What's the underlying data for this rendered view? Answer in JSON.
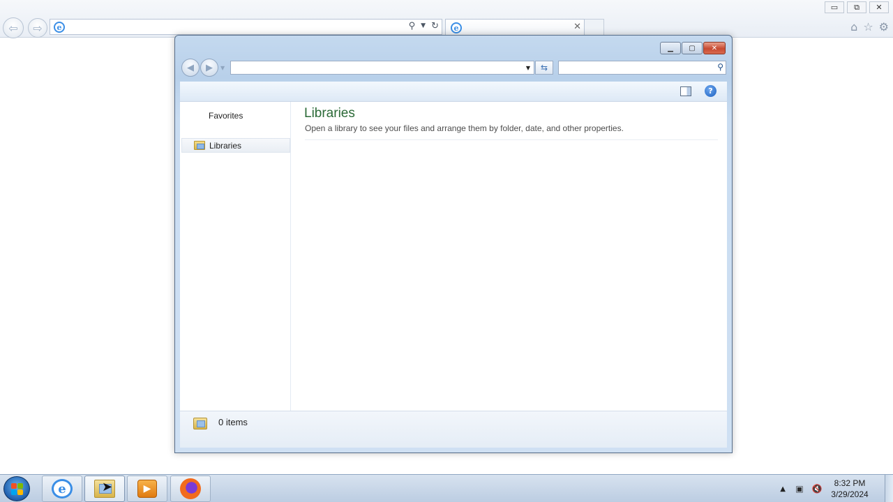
{
  "browser": {
    "address_value": "",
    "tab_title": "",
    "window_controls": {
      "minimize": "▭",
      "restore": "⧉",
      "close": "✕"
    },
    "toolbar_icons": [
      "home-icon",
      "star-icon",
      "gear-icon"
    ]
  },
  "explorer": {
    "address_value": "",
    "search_placeholder": "",
    "sidebar": {
      "favorites_label": "Favorites",
      "items": [
        {
          "label": "Libraries",
          "icon": "libraries-folder-icon",
          "selected": true
        }
      ]
    },
    "content": {
      "title": "Libraries",
      "description": "Open a library to see your files and arrange them by folder, date, and other properties."
    },
    "details": {
      "item_count": "0 items"
    },
    "colors": {
      "title_green": "#2b6a37",
      "frame_blue": "#b8d0ea",
      "close_red": "#c74a32"
    }
  },
  "taskbar": {
    "buttons": [
      {
        "name": "internet-explorer",
        "icon": "ie-icon"
      },
      {
        "name": "windows-explorer",
        "icon": "libraries-icon",
        "active": true
      },
      {
        "name": "media-player",
        "icon": "media-player-icon"
      },
      {
        "name": "firefox",
        "icon": "firefox-icon"
      }
    ],
    "clock": {
      "time": "8:32 PM",
      "date": "3/29/2024"
    }
  }
}
